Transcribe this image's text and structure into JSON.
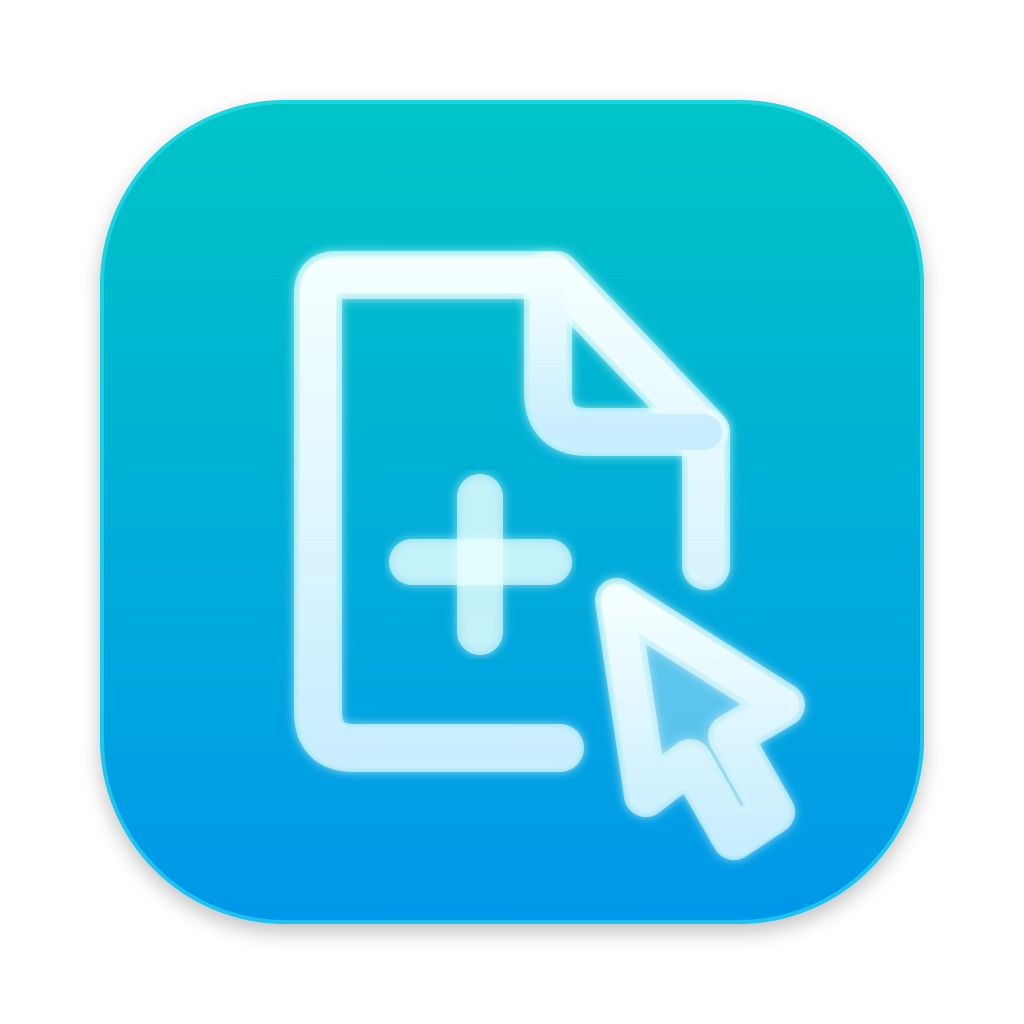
{
  "app_icon": {
    "name": "new-file-icon",
    "glyphs": [
      "document-icon",
      "plus-icon",
      "cursor-arrow-icon"
    ],
    "colors": {
      "gradient_top": "#02C5C6",
      "gradient_bottom": "#0398EA",
      "stroke": "#CFF6FF",
      "glow": "#E9FFFF"
    }
  }
}
